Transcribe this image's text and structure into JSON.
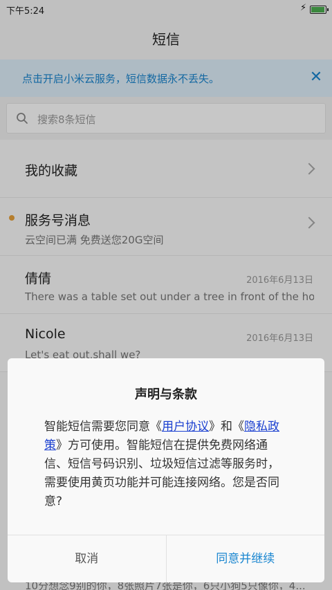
{
  "status_bar": {
    "time": "下午5:24",
    "charging_icon": "bolt-icon",
    "battery_icon": "battery-icon"
  },
  "header": {
    "title": "短信"
  },
  "banner": {
    "text": "点击开启小米云服务，短信数据永不丢失。",
    "close_icon": "close-icon"
  },
  "search": {
    "placeholder": "搜索8条短信",
    "icon": "search-icon"
  },
  "conversations": [
    {
      "name": "我的收藏",
      "chevron": "chevron-right-icon"
    },
    {
      "name": "服务号消息",
      "preview": "云空间已满 免费送您20G空间",
      "chevron": "chevron-right-icon",
      "unread_dot_color": "#e8a23c"
    },
    {
      "name": "倩倩",
      "preview": "There was a table set out under a tree in front of the ho...",
      "date": "2016年6月13日"
    },
    {
      "name": "Nicole",
      "preview": "Let's eat out,shall we?",
      "date": "2016年6月13日"
    }
  ],
  "partial_row": {
    "preview": "10分想念9别的你，8张照片7张是你，6只小狗5只像你，4..."
  },
  "dialog": {
    "title": "声明与条款",
    "body_before": "智能短信需要您同意《",
    "link_user_agreement": "用户协议",
    "body_mid": "》和《",
    "link_privacy": "隐私政策",
    "body_after": "》方可使用。智能短信在提供免费网络通信、短信号码识别、垃圾短信过滤等服务时，需要使用黄页功能并可能连接网络。您是否同意?",
    "cancel_label": "取消",
    "confirm_label": "同意并继续"
  },
  "colors": {
    "accent": "#1a86d0",
    "banner_bg": "#dff0fb",
    "link": "#1a3fd0"
  }
}
